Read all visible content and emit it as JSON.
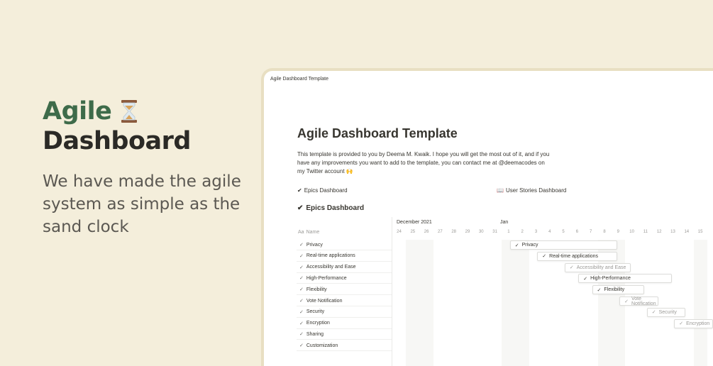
{
  "hero": {
    "title_line1": "Agile",
    "title_line2": "Dashboard",
    "subtitle": "We have made the agile system as simple as the sand clock"
  },
  "window": {
    "tab_title": "Agile Dashboard Template",
    "page_title": "Agile Dashboard Template",
    "description": "This template is provided to you by Deema M. Kwaik. I hope you will get the most out of it, and if you have any improvements you want to add to the template, you can contact me at @deemacodes on my Twitter account 🙌",
    "links": [
      {
        "label": "Epics Dashboard"
      },
      {
        "label": "User Stories Dashboard"
      }
    ],
    "section_title": "Epics Dashboard"
  },
  "timeline": {
    "month_label": "December 2021",
    "next_month_label": "Jan",
    "name_header": "Name",
    "days": [
      "24",
      "25",
      "26",
      "27",
      "28",
      "29",
      "30",
      "31",
      "1",
      "2",
      "3",
      "4",
      "5",
      "6",
      "7",
      "8",
      "9",
      "10",
      "11",
      "12",
      "13",
      "14",
      "15"
    ],
    "rows": [
      "Privacy",
      "Real-time applications",
      "Accessibility and Ease",
      "High-Performance",
      "Flexibility",
      "Vote Notification",
      "Security",
      "Encryption",
      "Sharing",
      "Customization"
    ],
    "bars": [
      {
        "label": "Privacy",
        "start_day_index": 9,
        "span_days": 7,
        "faded": false
      },
      {
        "label": "Real-time applications",
        "start_day_index": 11,
        "span_days": 5,
        "faded": false
      },
      {
        "label": "Accessibility and Ease",
        "start_day_index": 13,
        "span_days": 4,
        "faded": true
      },
      {
        "label": "High-Performance",
        "start_day_index": 14,
        "span_days": 6,
        "faded": false
      },
      {
        "label": "Flexibility",
        "start_day_index": 15,
        "span_days": 3,
        "faded": false
      },
      {
        "label": "Vote Notification",
        "start_day_index": 17,
        "span_days": 2,
        "faded": true
      },
      {
        "label": "Security",
        "start_day_index": 19,
        "span_days": 2,
        "faded": true
      },
      {
        "label": "Encryption",
        "start_day_index": 21,
        "span_days": 2,
        "faded": true
      }
    ],
    "weekend_day_indices": [
      1,
      2,
      8,
      9,
      15,
      16,
      22
    ]
  },
  "colors": {
    "background": "#f4eedb",
    "title_green": "#3e6b4a",
    "title_dark": "#2b2a26"
  }
}
